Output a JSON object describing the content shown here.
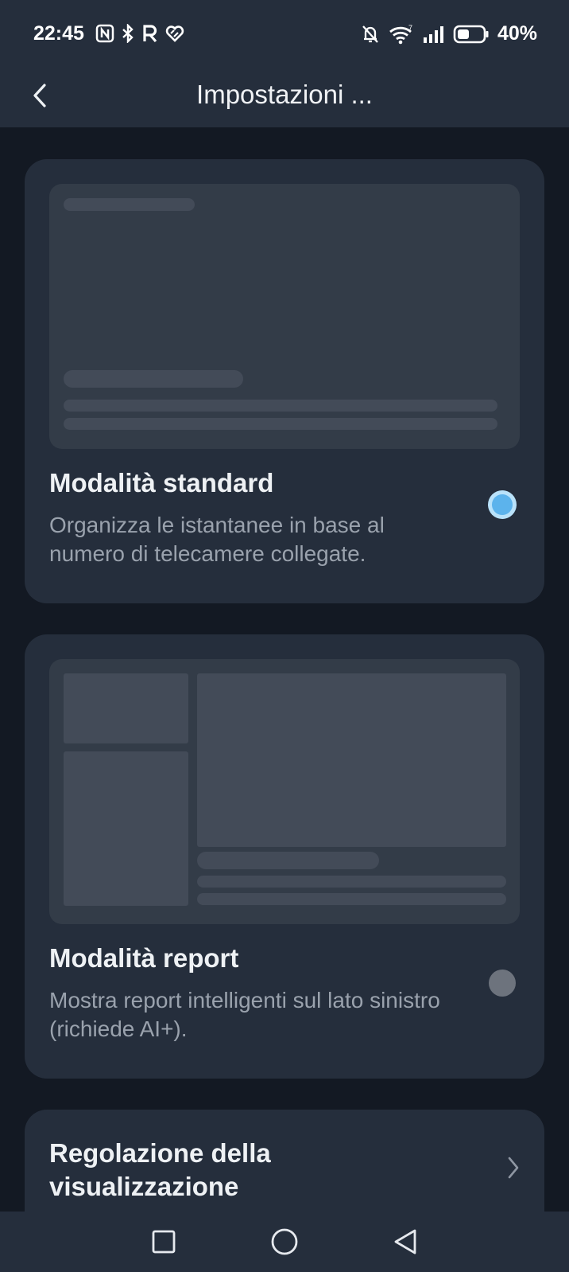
{
  "status_bar": {
    "time": "22:45",
    "left_icons": [
      "nfc-icon",
      "bluetooth-icon",
      "r-app-icon",
      "heart-app-icon"
    ],
    "right_icons": [
      "bell-muted-icon",
      "wifi-icon",
      "signal-icon",
      "battery-icon"
    ],
    "battery_percent": "40%"
  },
  "app_bar": {
    "title": "Impostazioni ...",
    "back_icon": "chevron-left-icon"
  },
  "modes": [
    {
      "title": "Modalità standard",
      "description": "Organizza le istantanee in base al numero di telecamere collegate.",
      "selected": true
    },
    {
      "title": "Modalità report",
      "description": "Mostra report intelligenti sul lato sinistro (richiede AI+).",
      "selected": false
    }
  ],
  "display_adjustment": {
    "label": "Regolazione della visualizzazione",
    "icon": "chevron-right-icon"
  },
  "nav_bar": {
    "items": [
      "square-recents-icon",
      "circle-home-icon",
      "triangle-back-icon"
    ]
  },
  "colors": {
    "accent": "#5cb3ec",
    "background": "#131923",
    "card": "#252e3c"
  }
}
